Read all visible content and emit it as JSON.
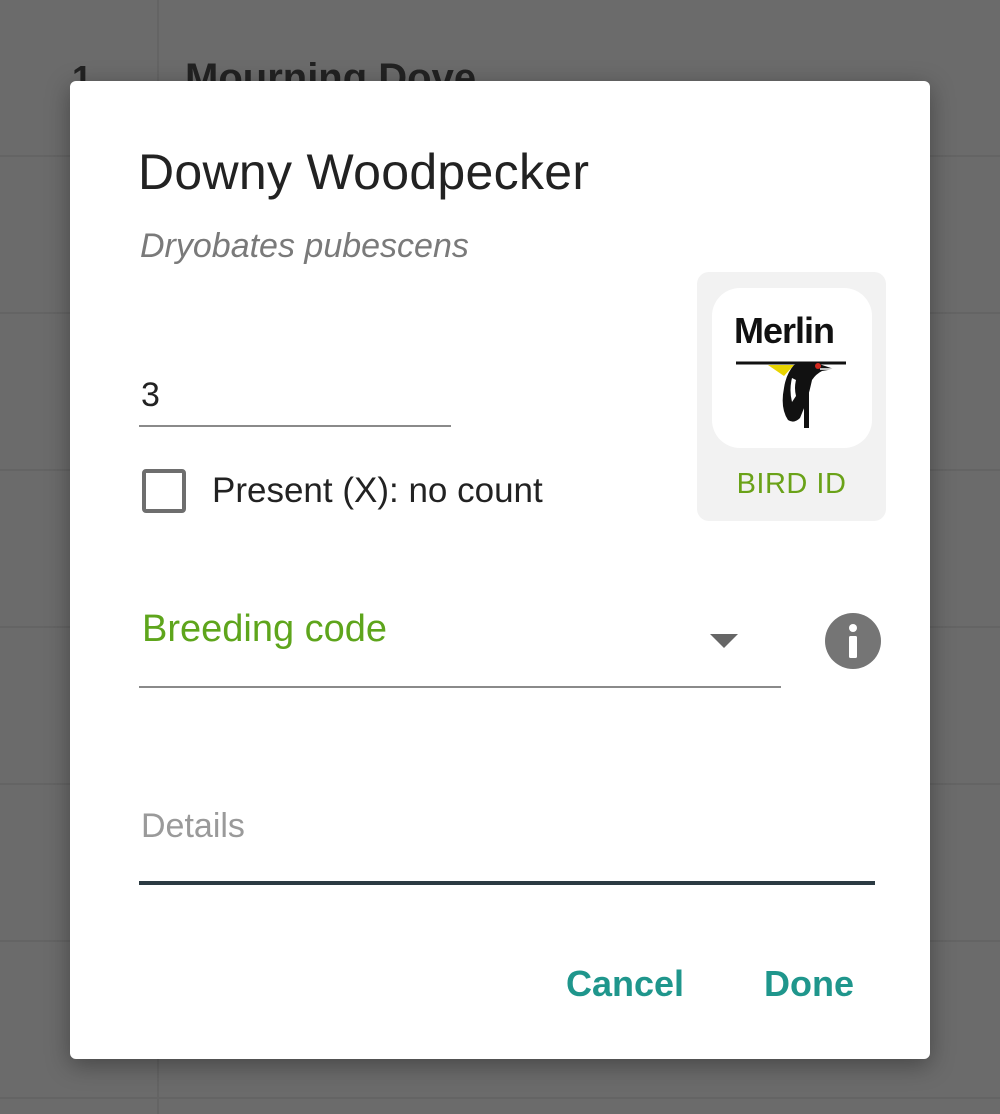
{
  "background": {
    "row_number": "1",
    "row_name": "Mourning Dove"
  },
  "dialog": {
    "title": "Downy Woodpecker",
    "subtitle": "Dryobates pubescens",
    "count_value": "3",
    "present_label": "Present (X): no count",
    "present_checked": false,
    "merlin": {
      "logo_text": "Merlin",
      "label": "BIRD ID"
    },
    "breeding_label": "Breeding code",
    "details_placeholder": "Details",
    "cancel_label": "Cancel",
    "done_label": "Done"
  },
  "colors": {
    "accent_teal": "#1f968c",
    "accent_green": "#5ea51c",
    "scrim": "#6b6b6b"
  },
  "icons": {
    "checkbox": "checkbox-unchecked-icon",
    "dropdown": "dropdown-arrow-icon",
    "info": "info-icon",
    "merlin": "merlin-bird-icon"
  }
}
